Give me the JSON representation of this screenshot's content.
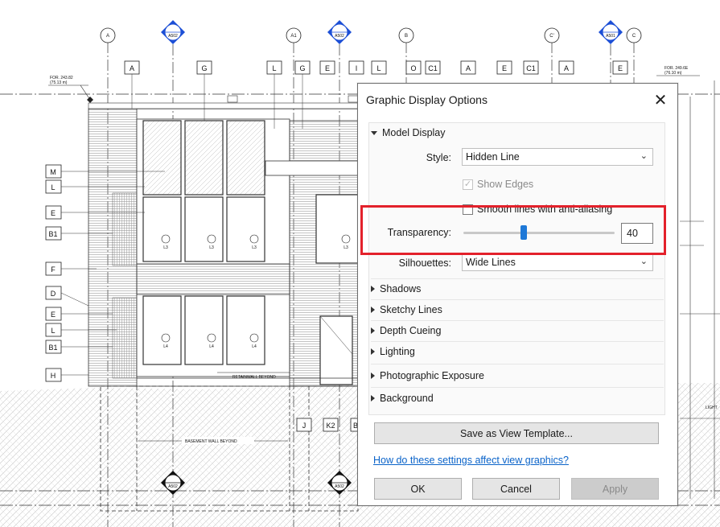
{
  "drawing": {
    "grid_labels": [
      "A",
      "A1",
      "B",
      "C'",
      "C"
    ],
    "section_top_labels": [
      "A502",
      "A502",
      "A501"
    ],
    "section_bottom_labels": [
      "A502",
      "A502"
    ],
    "top_tags": [
      "A",
      "G",
      "L",
      "G",
      "E",
      "I",
      "L",
      "O",
      "C1",
      "A",
      "E",
      "C1",
      "A",
      "E"
    ],
    "left_tags": [
      "M",
      "L",
      "E",
      "B1",
      "F",
      "D",
      "E",
      "L",
      "B1",
      "H"
    ],
    "bottom_tags": [
      "J",
      "K2",
      "B"
    ],
    "left_level_note": "FOR. 243.82",
    "left_level_sub": "(75.13 m)",
    "right_level_note": "FOR. 249.6E",
    "right_level_sub": "(76.10 m)",
    "window_tags": [
      "L3",
      "L3",
      "L3",
      "L3",
      "L4",
      "L4",
      "L4"
    ],
    "wall_note_1": "RETAINWALL BEYOND",
    "wall_note_2": "BASEMENT WALL BEYOND",
    "right_edge_text": "LIGHT"
  },
  "dialog": {
    "title": "Graphic Display Options",
    "close_glyph": "✕",
    "model_display": {
      "heading": "Model Display",
      "style_label": "Style:",
      "style_value": "Hidden Line",
      "show_edges_label": "Show Edges",
      "show_edges_checked": true,
      "show_edges_enabled": false,
      "smooth_lines_label": "Smooth lines with anti-aliasing",
      "smooth_lines_checked": false,
      "transparency_label": "Transparency:",
      "transparency_value": "40",
      "silhouettes_label": "Silhouettes:",
      "silhouettes_value": "Wide Lines"
    },
    "sections": [
      "Shadows",
      "Sketchy Lines",
      "Depth Cueing",
      "Lighting",
      "Photographic Exposure",
      "Background"
    ],
    "save_template_label": "Save as View Template...",
    "help_link": "How do these settings affect view graphics?",
    "ok_label": "OK",
    "cancel_label": "Cancel",
    "apply_label": "Apply",
    "apply_enabled": false
  },
  "icons": {
    "close": "close-icon",
    "expand": "triangle-down-icon",
    "collapse": "triangle-right-icon",
    "dropdown": "chevron-down-icon",
    "check": "checkmark-icon"
  },
  "colors": {
    "highlight": "#e3212b",
    "slider_thumb": "#1e78d7",
    "link": "#0a63c9",
    "section_marker": "#1c4fd6"
  }
}
